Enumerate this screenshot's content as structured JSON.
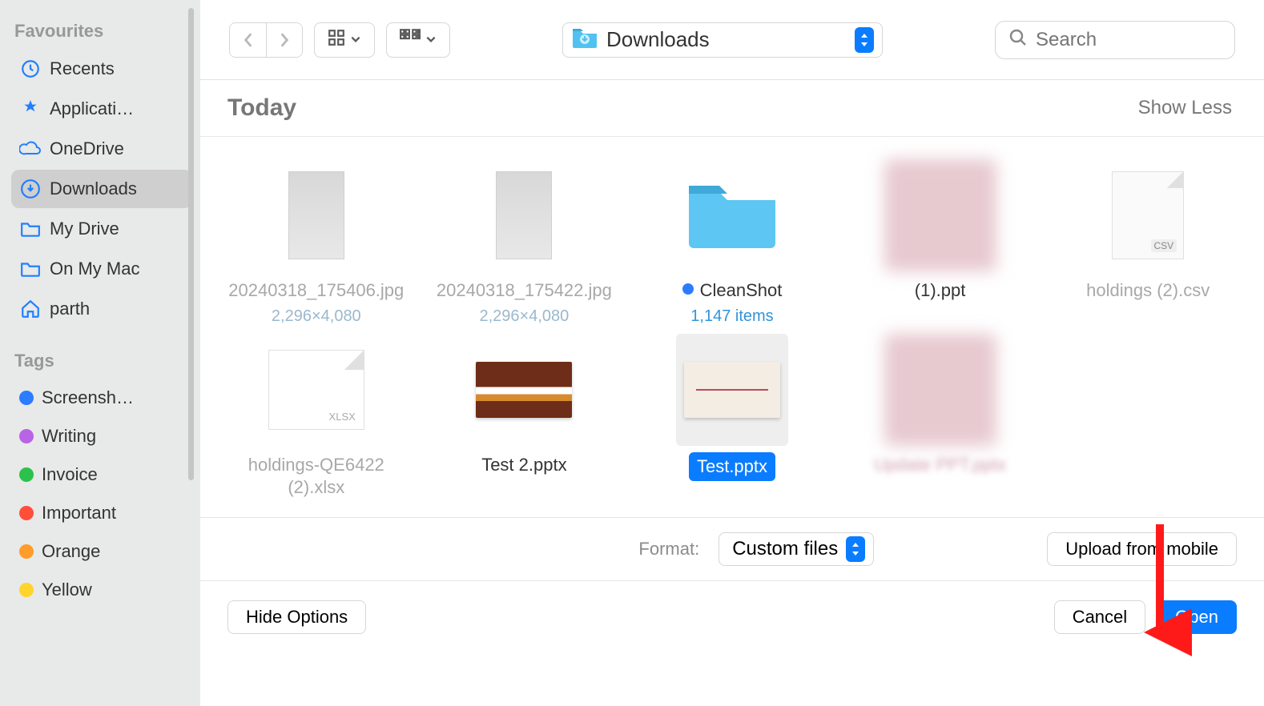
{
  "sidebar": {
    "favourites_heading": "Favourites",
    "tags_heading": "Tags",
    "items": [
      {
        "label": "Recents",
        "icon": "clock"
      },
      {
        "label": "Applicati…",
        "icon": "apps"
      },
      {
        "label": "OneDrive",
        "icon": "cloud"
      },
      {
        "label": "Downloads",
        "icon": "download",
        "selected": true
      },
      {
        "label": "My Drive",
        "icon": "folder"
      },
      {
        "label": "On My Mac",
        "icon": "folder"
      },
      {
        "label": "parth",
        "icon": "home"
      }
    ],
    "tags": [
      {
        "label": "Screensh…",
        "color": "#2b7cff"
      },
      {
        "label": "Writing",
        "color": "#b963e6"
      },
      {
        "label": "Invoice",
        "color": "#2bc24b"
      },
      {
        "label": "Important",
        "color": "#ff4f3a"
      },
      {
        "label": "Orange",
        "color": "#ff9c2b"
      },
      {
        "label": "Yellow",
        "color": "#ffd52b"
      }
    ]
  },
  "toolbar": {
    "location_label": "Downloads",
    "search_placeholder": "Search"
  },
  "section": {
    "heading": "Today",
    "show_less": "Show Less"
  },
  "files": [
    {
      "name": "20240318_175406.jpg",
      "meta": "2,296×4,080",
      "dim": true,
      "thumb": "image"
    },
    {
      "name": "20240318_175422.jpg",
      "meta": "2,296×4,080",
      "dim": true,
      "thumb": "image"
    },
    {
      "name": "CleanShot",
      "meta": "1,147 items",
      "thumb": "folder",
      "tagged": true,
      "meta_link": true
    },
    {
      "name": "(1).ppt",
      "thumb": "blurred"
    },
    {
      "name": "holdings (2).csv",
      "dim": true,
      "thumb": "csv"
    },
    {
      "name": "holdings-QE6422 (2).xlsx",
      "dim": true,
      "thumb": "xlsx"
    },
    {
      "name": "Test 2.pptx",
      "thumb": "ppt-a"
    },
    {
      "name": "Test.pptx",
      "thumb": "ppt-b",
      "selected": true
    },
    {
      "name": "Update PPT.pptx",
      "thumb": "blurred",
      "name_blurred": true
    }
  ],
  "footer": {
    "format_label": "Format:",
    "format_value": "Custom files",
    "upload_button": "Upload from mobile",
    "hide_options": "Hide Options",
    "cancel": "Cancel",
    "open": "Open"
  },
  "colors": {
    "accent_blue": "#0a7cff"
  }
}
